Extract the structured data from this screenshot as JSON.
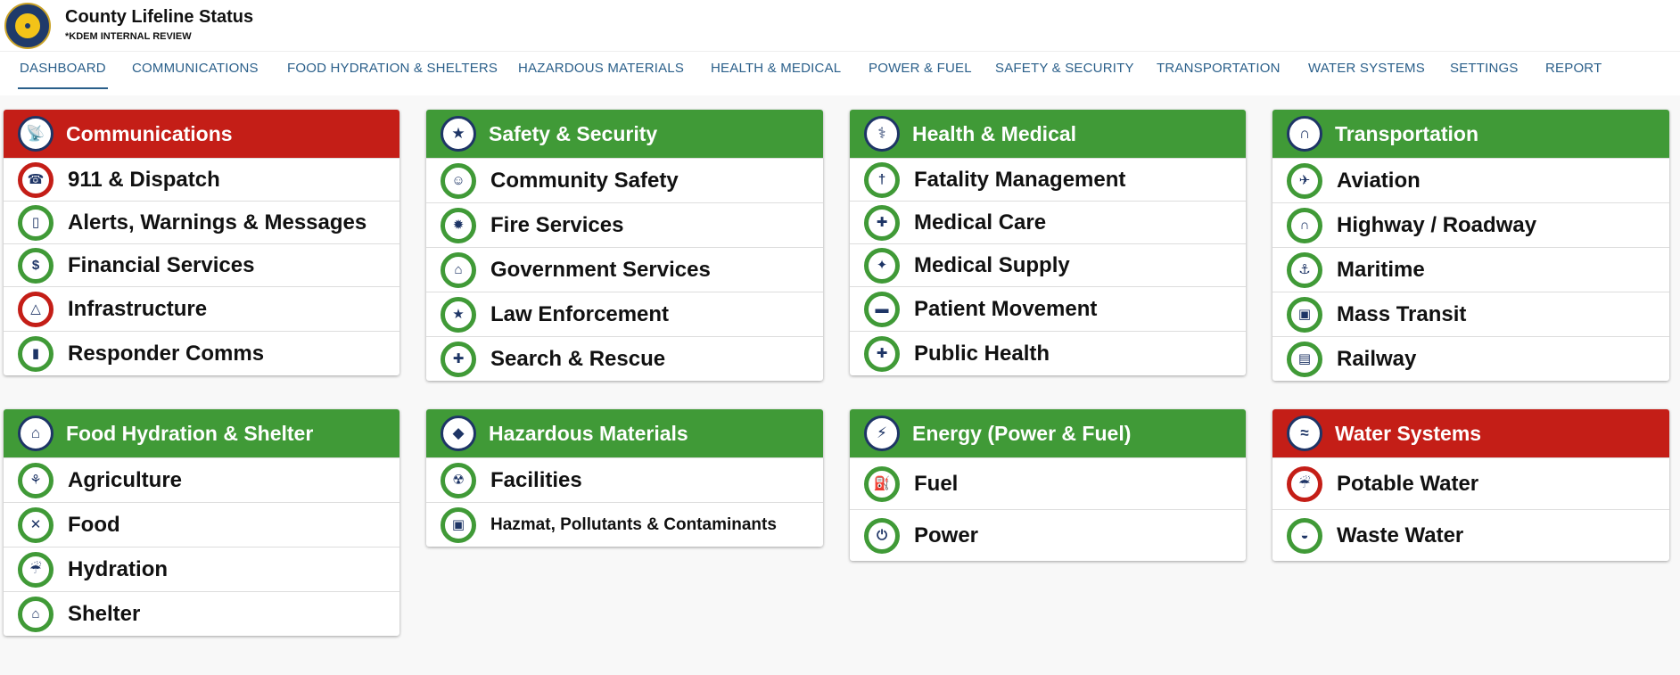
{
  "app": {
    "title": "County Lifeline Status",
    "subtitle": "*KDEM INTERNAL REVIEW"
  },
  "tabs": [
    {
      "label": "DASHBOARD"
    },
    {
      "label": "COMMUNICATIONS"
    },
    {
      "label": "FOOD HYDRATION & SHELTERS"
    },
    {
      "label": "HAZARDOUS MATERIALS"
    },
    {
      "label": "HEALTH & MEDICAL"
    },
    {
      "label": "POWER & FUEL"
    },
    {
      "label": "SAFETY & SECURITY"
    },
    {
      "label": "TRANSPORTATION"
    },
    {
      "label": "WATER SYSTEMS"
    },
    {
      "label": "SETTINGS"
    },
    {
      "label": "REPORT"
    }
  ],
  "colors": {
    "ok": "#409a37",
    "alert": "#c41e17",
    "tab_text": "#2a5f8a",
    "icon_navy": "#1e3566"
  },
  "cards": [
    {
      "title": "Communications",
      "status": "alert",
      "icon": "antenna-icon",
      "items": [
        {
          "label": "911 & Dispatch",
          "status": "alert",
          "icon": "911-icon"
        },
        {
          "label": "Alerts, Warnings & Messages",
          "status": "ok",
          "icon": "mobile-alert-icon"
        },
        {
          "label": "Financial Services",
          "status": "ok",
          "icon": "money-icon"
        },
        {
          "label": "Infrastructure",
          "status": "alert",
          "icon": "cell-tower-icon"
        },
        {
          "label": "Responder Comms",
          "status": "ok",
          "icon": "radio-icon"
        }
      ]
    },
    {
      "title": "Safety & Security",
      "status": "ok",
      "icon": "police-badge-icon",
      "items": [
        {
          "label": "Community Safety",
          "status": "ok",
          "icon": "people-icon"
        },
        {
          "label": "Fire Services",
          "status": "ok",
          "icon": "fire-icon"
        },
        {
          "label": "Government Services",
          "status": "ok",
          "icon": "government-building-icon"
        },
        {
          "label": "Law Enforcement",
          "status": "ok",
          "icon": "badge-icon"
        },
        {
          "label": "Search & Rescue",
          "status": "ok",
          "icon": "rescue-cross-icon"
        }
      ]
    },
    {
      "title": "Health & Medical",
      "status": "ok",
      "icon": "caduceus-icon",
      "items": [
        {
          "label": "Fatality Management",
          "status": "ok",
          "icon": "fatality-icon"
        },
        {
          "label": "Medical Care",
          "status": "ok",
          "icon": "medical-care-icon"
        },
        {
          "label": "Medical Supply",
          "status": "ok",
          "icon": "medical-supply-icon"
        },
        {
          "label": "Patient Movement",
          "status": "ok",
          "icon": "ambulance-icon"
        },
        {
          "label": "Public Health",
          "status": "ok",
          "icon": "public-health-icon"
        }
      ]
    },
    {
      "title": "Transportation",
      "status": "ok",
      "icon": "bridge-icon",
      "items": [
        {
          "label": "Aviation",
          "status": "ok",
          "icon": "airplane-icon"
        },
        {
          "label": "Highway / Roadway",
          "status": "ok",
          "icon": "highway-icon"
        },
        {
          "label": "Maritime",
          "status": "ok",
          "icon": "ship-icon"
        },
        {
          "label": "Mass Transit",
          "status": "ok",
          "icon": "bus-icon"
        },
        {
          "label": "Railway",
          "status": "ok",
          "icon": "train-icon"
        }
      ]
    },
    {
      "title": "Food Hydration & Shelter",
      "status": "ok",
      "icon": "shelter-food-icon",
      "items": [
        {
          "label": "Agriculture",
          "status": "ok",
          "icon": "cow-icon"
        },
        {
          "label": "Food",
          "status": "ok",
          "icon": "fork-knife-icon"
        },
        {
          "label": "Hydration",
          "status": "ok",
          "icon": "faucet-icon"
        },
        {
          "label": "Shelter",
          "status": "ok",
          "icon": "shelter-icon"
        }
      ]
    },
    {
      "title": "Hazardous Materials",
      "status": "ok",
      "icon": "hazmat-icon",
      "items": [
        {
          "label": "Facilities",
          "status": "ok",
          "icon": "facility-icon"
        },
        {
          "label": "Hazmat, Pollutants & Contaminants",
          "status": "ok",
          "icon": "hazmat-truck-icon"
        }
      ]
    },
    {
      "title": "Energy (Power & Fuel)",
      "status": "ok",
      "icon": "energy-icon",
      "items": [
        {
          "label": "Fuel",
          "status": "ok",
          "icon": "fuel-pump-icon"
        },
        {
          "label": "Power",
          "status": "ok",
          "icon": "plug-icon"
        }
      ]
    },
    {
      "title": "Water Systems",
      "status": "alert",
      "icon": "water-system-icon",
      "items": [
        {
          "label": "Potable Water",
          "status": "alert",
          "icon": "water-faucet-icon"
        },
        {
          "label": "Waste Water",
          "status": "ok",
          "icon": "waste-water-icon"
        }
      ]
    }
  ]
}
